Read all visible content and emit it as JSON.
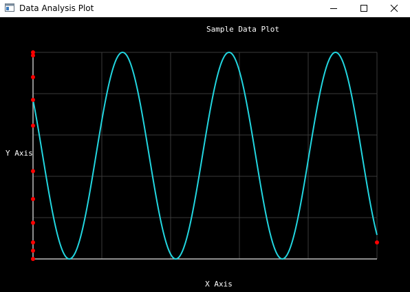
{
  "window": {
    "title": "Data Analysis Plot",
    "controls": {
      "minimize": "minimize",
      "maximize": "maximize",
      "close": "close"
    },
    "icon": "app-window-icon"
  },
  "colors": {
    "background": "#000000",
    "grid": "#3a3a3a",
    "axis": "#bdbdbd",
    "curve": "#22d6e0",
    "points": "#ff0000"
  },
  "chart_data": {
    "type": "line",
    "title": "Sample Data Plot",
    "xlabel": "X Axis",
    "ylabel": "Y Axis",
    "grid": true,
    "xlim": [
      0,
      5
    ],
    "ylim": [
      0,
      1
    ],
    "series": [
      {
        "kind": "line",
        "function": "sine",
        "amplitude": 0.5,
        "offset": 0.5,
        "periods": 3.23,
        "start_value": 0.77,
        "end_value": 0.23,
        "color": "#22d6e0"
      },
      {
        "kind": "scatter",
        "color": "#ff0000",
        "points": [
          {
            "x": 0,
            "y": 1.0
          },
          {
            "x": 0,
            "y": 0.985
          },
          {
            "x": 0,
            "y": 0.88
          },
          {
            "x": 0,
            "y": 0.77
          },
          {
            "x": 0,
            "y": 0.645
          },
          {
            "x": 0,
            "y": 0.425
          },
          {
            "x": 0,
            "y": 0.29
          },
          {
            "x": 0,
            "y": 0.175
          },
          {
            "x": 0,
            "y": 0.08
          },
          {
            "x": 0,
            "y": 0.04
          },
          {
            "x": 0,
            "y": 0.0
          },
          {
            "x": 5,
            "y": 0.08
          }
        ]
      }
    ]
  }
}
